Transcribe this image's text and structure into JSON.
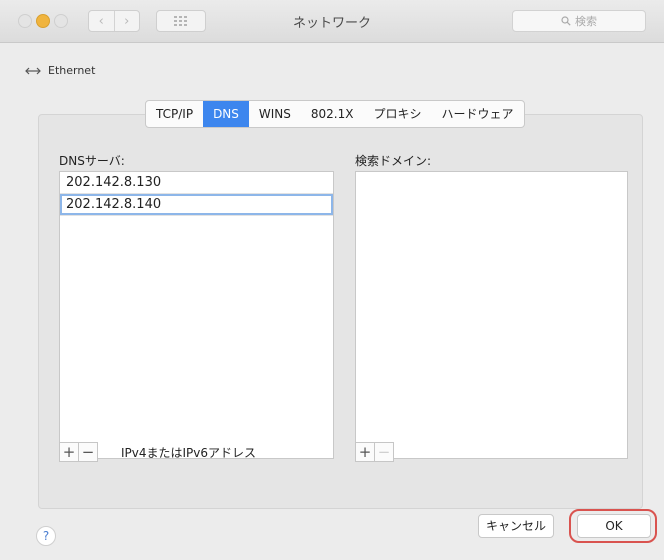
{
  "window": {
    "title": "ネットワーク"
  },
  "toolbar": {
    "back_glyph": "‹",
    "forward_glyph": "›",
    "search_placeholder": "検索"
  },
  "interface": {
    "name": "Ethernet"
  },
  "tabs": [
    {
      "label": "TCP/IP",
      "selected": false
    },
    {
      "label": "DNS",
      "selected": true
    },
    {
      "label": "WINS",
      "selected": false
    },
    {
      "label": "802.1X",
      "selected": false
    },
    {
      "label": "プロキシ",
      "selected": false
    },
    {
      "label": "ハードウェア",
      "selected": false
    }
  ],
  "dns": {
    "label": "DNSサーバ:",
    "servers": [
      "202.142.8.130",
      "202.142.8.140"
    ],
    "hint": "IPv4またはIPv6アドレス"
  },
  "search_domains": {
    "label": "検索ドメイン:",
    "items": []
  },
  "footer": {
    "help_label": "?",
    "cancel_label": "キャンセル",
    "ok_label": "OK"
  },
  "controls": {
    "add_label": "+",
    "remove_label": "−"
  },
  "colors": {
    "accent": "#3d86ee",
    "highlight": "#d9534f"
  }
}
